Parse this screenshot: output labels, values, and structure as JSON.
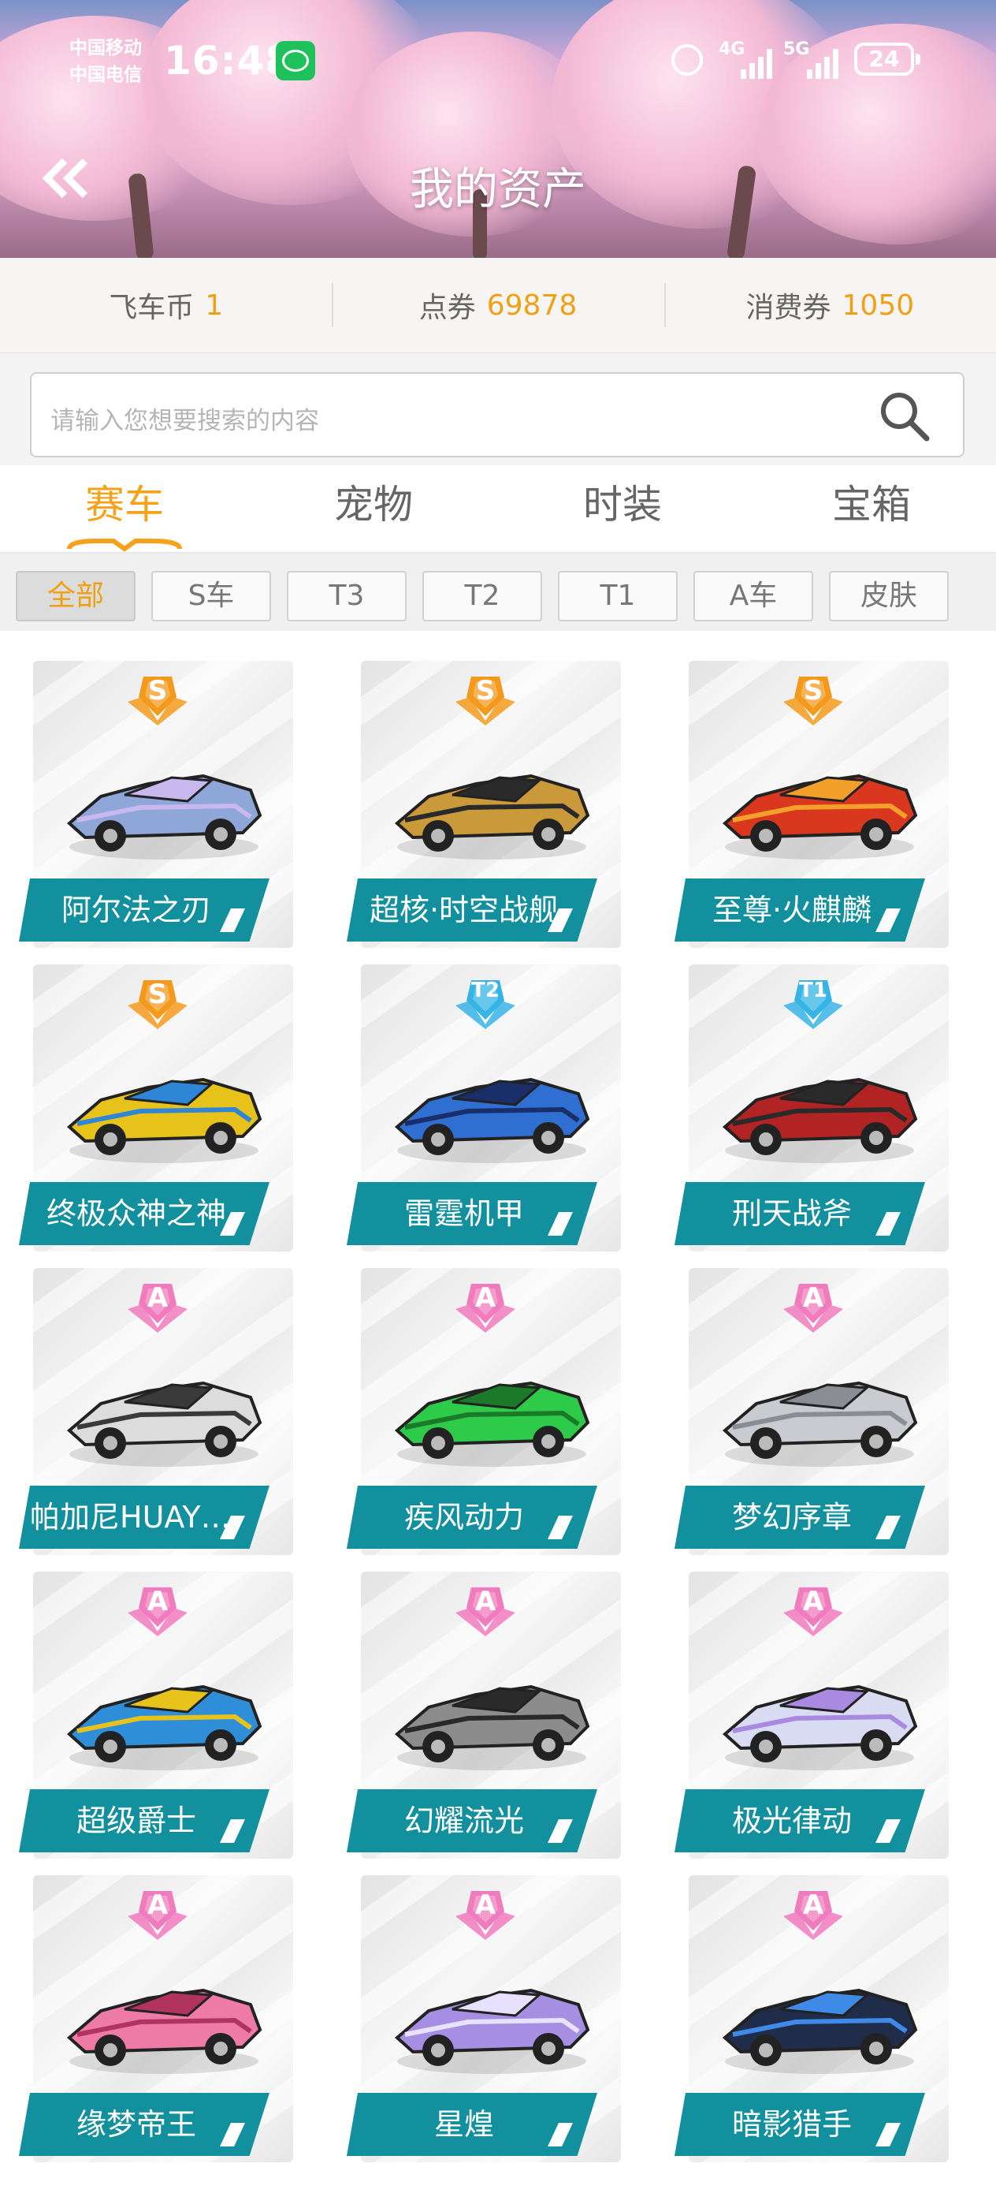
{
  "status_bar": {
    "carrier1": "中国移动",
    "carrier2": "中国电信",
    "time": "16:48",
    "network1": "4G",
    "network2": "5G",
    "battery": "24"
  },
  "header": {
    "title": "我的资产",
    "back_icon": "double-chevron-left"
  },
  "currencies": [
    {
      "label": "飞车币",
      "value": "1"
    },
    {
      "label": "点券",
      "value": "69878"
    },
    {
      "label": "消费券",
      "value": "1050"
    }
  ],
  "search": {
    "placeholder": "请输入您想要搜索的内容"
  },
  "tabs": [
    {
      "label": "赛车",
      "active": true
    },
    {
      "label": "宠物",
      "active": false
    },
    {
      "label": "时装",
      "active": false
    },
    {
      "label": "宝箱",
      "active": false
    }
  ],
  "filters": [
    {
      "label": "全部",
      "active": true
    },
    {
      "label": "S车",
      "active": false
    },
    {
      "label": "T3",
      "active": false
    },
    {
      "label": "T2",
      "active": false
    },
    {
      "label": "T1",
      "active": false
    },
    {
      "label": "A车",
      "active": false
    },
    {
      "label": "皮肤",
      "active": false
    }
  ],
  "colors": {
    "accent": "#f5a21a",
    "ribbon": "#12909e"
  },
  "cars": [
    {
      "name": "阿尔法之刃",
      "grade": "S",
      "color": "#8fa6d8",
      "accent": "#c9b8ee"
    },
    {
      "name": "超核·时空战舰",
      "grade": "S",
      "color": "#c9993a",
      "accent": "#2a2a2a"
    },
    {
      "name": "至尊·火麒麟",
      "grade": "S",
      "color": "#d9381e",
      "accent": "#f2a02a"
    },
    {
      "name": "终极众神之神",
      "grade": "S",
      "color": "#e6c21a",
      "accent": "#2f86d6"
    },
    {
      "name": "雷霆机甲",
      "grade": "T2",
      "color": "#2f6fd1",
      "accent": "#1a2f6a"
    },
    {
      "name": "刑天战斧",
      "grade": "T1",
      "color": "#b22424",
      "accent": "#2a2a2a"
    },
    {
      "name": "帕加尼HUAYRA...",
      "grade": "A",
      "color": "#dcdcdc",
      "accent": "#3a3a3a"
    },
    {
      "name": "疾风动力",
      "grade": "A",
      "color": "#2ecb4a",
      "accent": "#1b7a2a"
    },
    {
      "name": "梦幻序章",
      "grade": "A",
      "color": "#c9cbd0",
      "accent": "#8a8d94"
    },
    {
      "name": "超级爵士",
      "grade": "A",
      "color": "#2e8fd8",
      "accent": "#e6c21a"
    },
    {
      "name": "幻耀流光",
      "grade": "A",
      "color": "#8c8c8c",
      "accent": "#2a2a2a"
    },
    {
      "name": "极光律动",
      "grade": "A",
      "color": "#d9dbf2",
      "accent": "#a88be0"
    },
    {
      "name": "缘梦帝王",
      "grade": "A",
      "color": "#ee7aa6",
      "accent": "#b0345e"
    },
    {
      "name": "星煌",
      "grade": "A",
      "color": "#a68ee2",
      "accent": "#e9e2ff"
    },
    {
      "name": "暗影猎手",
      "grade": "A",
      "color": "#1f2c4a",
      "accent": "#3f8ae6"
    }
  ]
}
